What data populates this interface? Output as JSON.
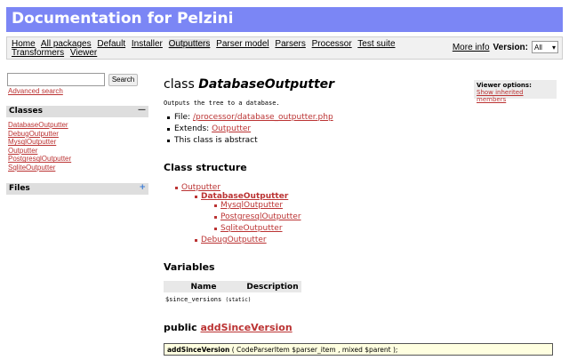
{
  "header": {
    "title": "Documentation for Pelzini"
  },
  "nav": {
    "links": [
      {
        "label": "Home"
      },
      {
        "label": "All packages"
      },
      {
        "label": "Default"
      },
      {
        "label": "Installer"
      },
      {
        "label": "Outputters",
        "active": true
      },
      {
        "label": "Parser model"
      },
      {
        "label": "Parsers"
      },
      {
        "label": "Processor"
      },
      {
        "label": "Test suite"
      },
      {
        "label": "Transformers"
      },
      {
        "label": "Viewer"
      }
    ],
    "more_info": "More info",
    "version_label": "Version:",
    "version_value": "All"
  },
  "sidebar": {
    "search_value": "",
    "search_button": "Search",
    "advanced_search": "Advanced search",
    "classes_heading": "Classes",
    "classes_ctrl": "—",
    "classes": [
      "DatabaseOutputter",
      "DebugOutputter",
      "MysqlOutputter",
      "Outputter",
      "PostgresqlOutputter",
      "SqliteOutputter"
    ],
    "files_heading": "Files",
    "files_ctrl": "+"
  },
  "main": {
    "title_prefix": "class",
    "class_name": "DatabaseOutputter",
    "description": "Outputs the tree to a database.",
    "file_label": "File:",
    "file_path": "/processor/database_outputter.php",
    "extends_label": "Extends:",
    "extends_value": "Outputter",
    "abstract_note": "This class is abstract",
    "viewer_options": {
      "title": "Viewer options:",
      "link": "Show inherited members"
    },
    "structure_heading": "Class structure",
    "tree": {
      "root": "Outputter",
      "current": "DatabaseOutputter",
      "children": [
        "MysqlOutputter",
        "PostgresqlOutputter",
        "SqliteOutputter"
      ],
      "sibling": "DebugOutputter"
    },
    "variables_heading": "Variables",
    "variables_columns": [
      "Name",
      "Description"
    ],
    "variables_rows": [
      {
        "name": "$since_versions",
        "tag": "(static)"
      }
    ],
    "method_prefix": "public",
    "method_name": "addSinceVersion",
    "signature": {
      "name": "addSinceVersion",
      "params": "( CodeParserItem $parser_item , mixed $parent );"
    }
  }
}
